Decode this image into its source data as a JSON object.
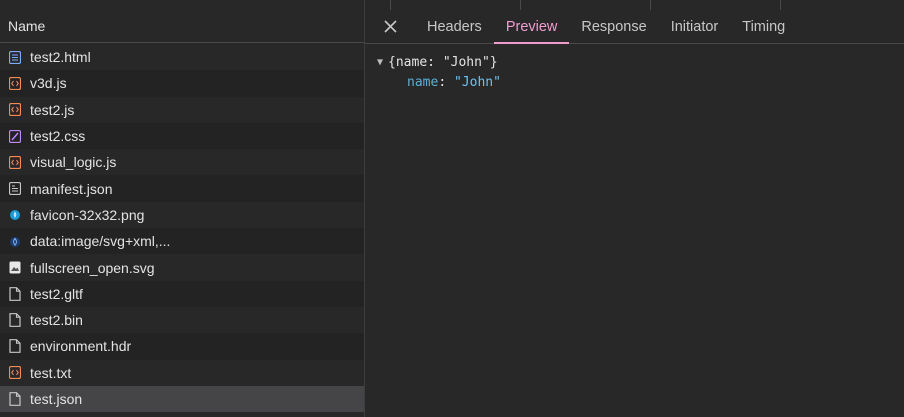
{
  "left_panel": {
    "column_header": "Name",
    "rows": [
      {
        "name": "test2.html",
        "icon": "document-icon"
      },
      {
        "name": "v3d.js",
        "icon": "script-icon"
      },
      {
        "name": "test2.js",
        "icon": "script-icon"
      },
      {
        "name": "test2.css",
        "icon": "stylesheet-icon"
      },
      {
        "name": "visual_logic.js",
        "icon": "script-icon"
      },
      {
        "name": "manifest.json",
        "icon": "manifest-icon"
      },
      {
        "name": "favicon-32x32.png",
        "icon": "favicon-icon"
      },
      {
        "name": "data:image/svg+xml,...",
        "icon": "svg-image-icon"
      },
      {
        "name": "fullscreen_open.svg",
        "icon": "image-icon"
      },
      {
        "name": "test2.gltf",
        "icon": "file-icon"
      },
      {
        "name": "test2.bin",
        "icon": "file-icon"
      },
      {
        "name": "environment.hdr",
        "icon": "file-icon"
      },
      {
        "name": "test.txt",
        "icon": "script-icon"
      },
      {
        "name": "test.json",
        "icon": "file-icon",
        "selected": true
      }
    ]
  },
  "right_panel": {
    "tabs": [
      "Headers",
      "Preview",
      "Response",
      "Initiator",
      "Timing"
    ],
    "active_tab": "Preview",
    "preview": {
      "summary_open": "{name: ",
      "summary_value": "\"John\"",
      "summary_close": "}",
      "key": "name",
      "colon": ": ",
      "value": "\"John\""
    }
  },
  "colors": {
    "accent": "#f19bd1",
    "script_icon": "#f28b54",
    "document_icon": "#7cacf8",
    "stylesheet_icon": "#c58af9",
    "json_key": "#5db0d7",
    "json_string": "#6ec3f5"
  }
}
